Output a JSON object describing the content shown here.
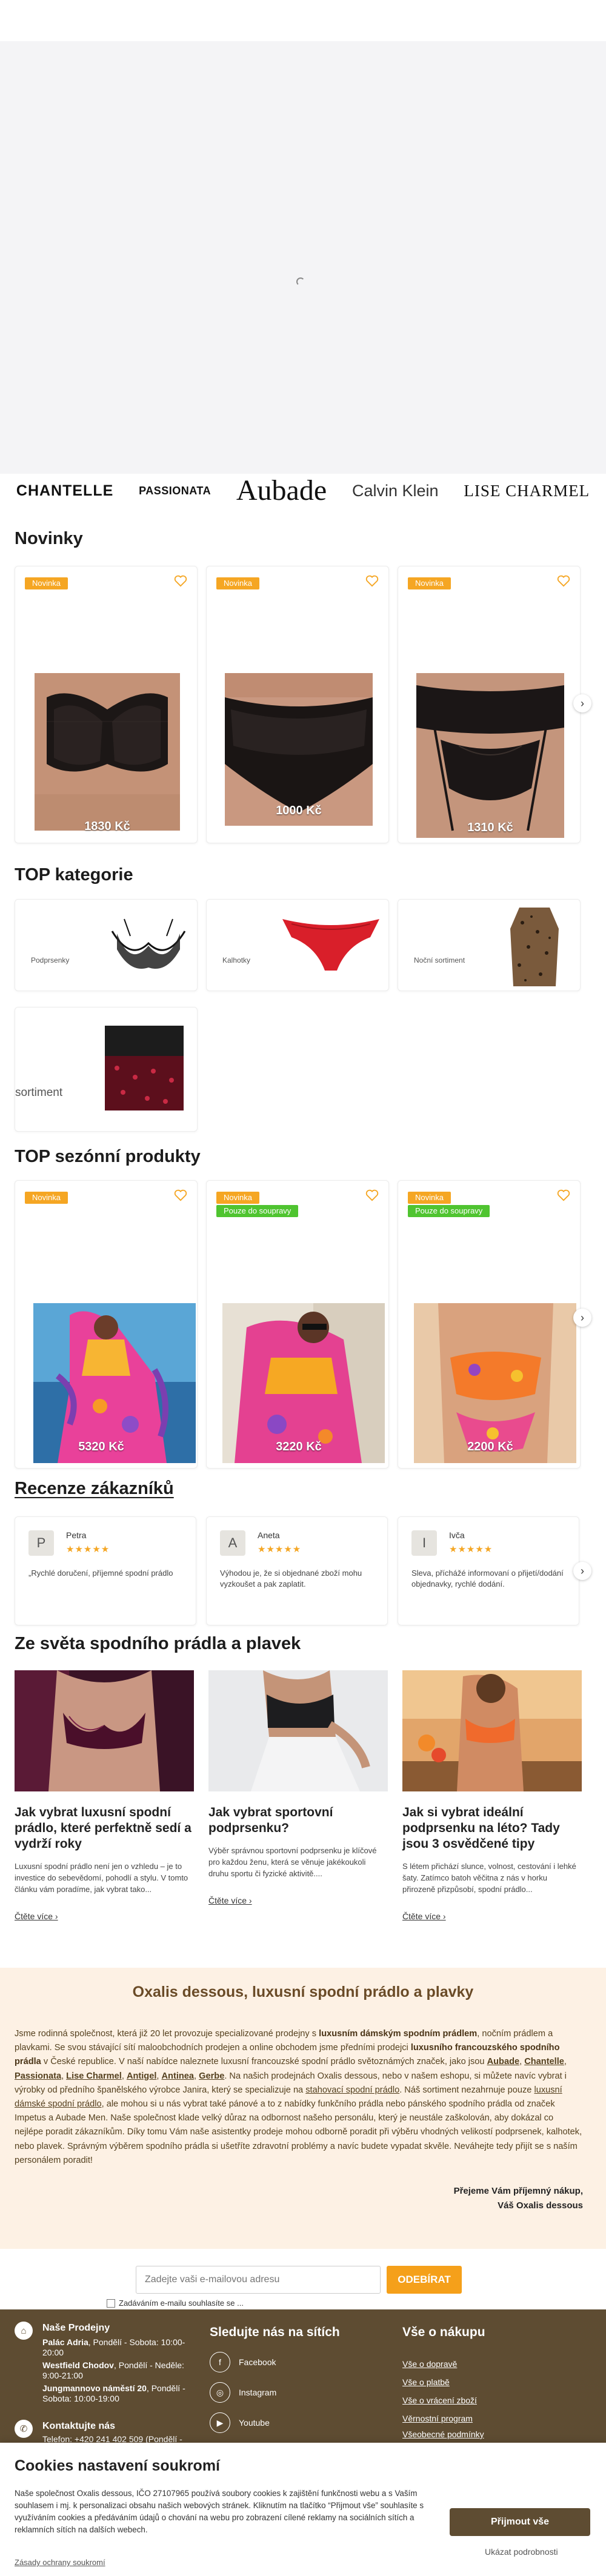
{
  "brands": [
    "CHANTELLE",
    "PASSIONATA",
    "Aubade",
    "Calvin Klein",
    "LISE CHARMEL"
  ],
  "new_section": {
    "title": "Novinky",
    "products": [
      {
        "badge": "Novinka",
        "price": "1830 Kč"
      },
      {
        "badge": "Novinka",
        "price": "1000 Kč"
      },
      {
        "badge": "Novinka",
        "price": "1310 Kč"
      }
    ]
  },
  "categories_section": {
    "title": "TOP kategorie",
    "items": [
      {
        "label": "Podprsenky"
      },
      {
        "label": "Kalhotky"
      },
      {
        "label": "Noční sortiment"
      },
      {
        "label": "sortiment"
      }
    ]
  },
  "seasonal_section": {
    "title": "TOP sezónní produkty",
    "products": [
      {
        "badge": "Novinka",
        "badge2": "",
        "price": "5320 Kč"
      },
      {
        "badge": "Novinka",
        "badge2": "Pouze do soupravy",
        "price": "3220 Kč"
      },
      {
        "badge": "Novinka",
        "badge2": "Pouze do soupravy",
        "price": "2200 Kč"
      }
    ]
  },
  "reviews_section": {
    "title": "Recenze zákazníků",
    "items": [
      {
        "initial": "P",
        "name": "Petra",
        "stars": "★★★★★",
        "text": "„Rychlé doručení, příjemné spodní prádlo"
      },
      {
        "initial": "A",
        "name": "Aneta",
        "stars": "★★★★★",
        "text": "Výhodou je, že si objednané zboží mohu vyzkoušet a pak zaplatit."
      },
      {
        "initial": "I",
        "name": "Ivča",
        "stars": "★★★★★",
        "text": "Sleva, příchážé informovaní o přijetí/dodání objednavky, rychlé dodání."
      }
    ]
  },
  "articles_section": {
    "title": "Ze světa spodního prádla a plavek",
    "items": [
      {
        "title": "Jak vybrat luxusní spodní prádlo, které perfektně sedí a vydrží roky",
        "text": "Luxusní spodní prádlo není jen o vzhledu – je to investice do sebevědomí, pohodlí a stylu. V tomto článku vám poradíme, jak vybrat tako...",
        "link": "Čtěte více"
      },
      {
        "title": "Jak vybrat sportovní podprsenku?",
        "text": "Výběr správnou sportovní podprsenku je klíčové pro každou ženu, která se věnuje jakékoukoli druhu sportu či fyzické aktivitě....",
        "link": "Čtěte více"
      },
      {
        "title": "Jak si vybrat ideální podprsenku na léto? Tady jsou 3 osvědčené tipy",
        "text": "S létem přichází slunce, volnost, cestování i lehké šaty. Zatímco batoh věčitna z nás v horku přirozeně přizpůsobí, spodní prádlo...",
        "link": "Čtěte více"
      }
    ]
  },
  "about": {
    "title": "Oxalis dessous, luxusní spodní prádlo a plavky",
    "p1": "Jsme rodinná společnost, která již 20 let provozuje specializované prodejny s ",
    "p1b": "luxusním dámským spodním prádlem",
    "p2": ", nočním prádlem a plavkami. Se svou stávající sítí maloobchodních prodejen a online obchodem jsme předními prodejci ",
    "p2b": "luxusního francouzského spodního prádla",
    "p3": " v České republice. V naší nabídce naleznete luxusní francouzské spodní prádlo světoznámých značek, jako jsou ",
    "brand_links": [
      "Aubade",
      "Chantelle",
      "Passionata",
      "Lise Charmel",
      "Antigel",
      "Antinea",
      "Gerbe"
    ],
    "p4": ". Na našich prodejnách Oxalis dessous, nebo v našem eshopu, si můžete navíc vybrat i výrobky od předního španělského výrobce Janira, který se specializuje na ",
    "link_shaping": "stahovací spodní prádlo",
    "p5": ". Náš sortiment nezahrnuje pouze ",
    "link_lingerie": "luxusní dámské spodní prádlo",
    "p6": ", ale mohou si u nás vybrat také pánové a to z nabídky funkčního prádla nebo pánského spodního prádla od značek Impetus a Aubade Men. Naše společnost klade velký důraz na odbornost našeho personálu, který je neustále zaškolován, aby dokázal co nejlépe poradit zákazníkům. Díky tomu Vám naše asistentky prodeje mohou odborně poradit při výběru vhodných velikostí podprsenek, kalhotek, nebo plavek. Správným výběrem spodního prádla si ušetříte zdravotní problémy a navíc budete vypadat skvěle. Neváhejte tedy přijít se s naším personálem poradit!",
    "sign1": "Přejeme Vám příjemný nákup,",
    "sign2": "Váš Oxalis dessous"
  },
  "newsletter": {
    "placeholder": "Zadejte vaši e-mailovou adresu",
    "button": "ODEBÍRAT",
    "consent": "Zadáváním e-mailu souhlasíte se ..."
  },
  "footer": {
    "stores_title": "Naše Prodejny",
    "stores": [
      {
        "name": "Palác Adria",
        "hours": ", Pondělí - Sobota: 10:00-20:00"
      },
      {
        "name": "Westfield Chodov",
        "hours": ", Pondělí - Neděle: 9:00-21:00"
      },
      {
        "name": "Jungmannovo náměstí 20",
        "hours": ", Pondělí - Sobota: 10:00-19:00"
      }
    ],
    "contact_title": "Kontaktujte nás",
    "contact_phone": "Telefon: +420 241 402 509 (Pondělí -",
    "social_title": "Sledujte nás na sítích",
    "social": [
      {
        "icon": "facebook-icon",
        "label": "Facebook"
      },
      {
        "icon": "instagram-icon",
        "label": "Instagram"
      },
      {
        "icon": "youtube-icon",
        "label": "Youtube"
      }
    ],
    "shop_title": "Vše o nákupu",
    "shop_links": [
      "Vše o dopravě",
      "Vše o platbě",
      "Vše o vrácení zboží",
      "Věrnostní program",
      "Všeobecné podmínky"
    ]
  },
  "cookie": {
    "title": "Cookies nastavení soukromí",
    "text1": "Naše společnost Oxalis dessous, IČO 27107965 používá soubory cookies k zajištění funkčnosti webu a s Vaším souhlasem i mj. k personalizaci obsahu našich webových stránek. Kliknutím na tlačítko “Přijmout vše” souhlasíte s využíváním cookies a předáváním údajů o chování na webu pro zobrazení cílené reklamy na sociálních sítích a reklamních sítích na dalších webech.",
    "accept": "Přijmout vše",
    "decline": "Ukázat podrobnosti",
    "settings": "Zásady ochrany soukromí"
  },
  "colors": {
    "accent": "#f5a623",
    "badge_green": "#4fc430",
    "brown": "#5e4c32",
    "about_bg": "#fdf1e4"
  }
}
